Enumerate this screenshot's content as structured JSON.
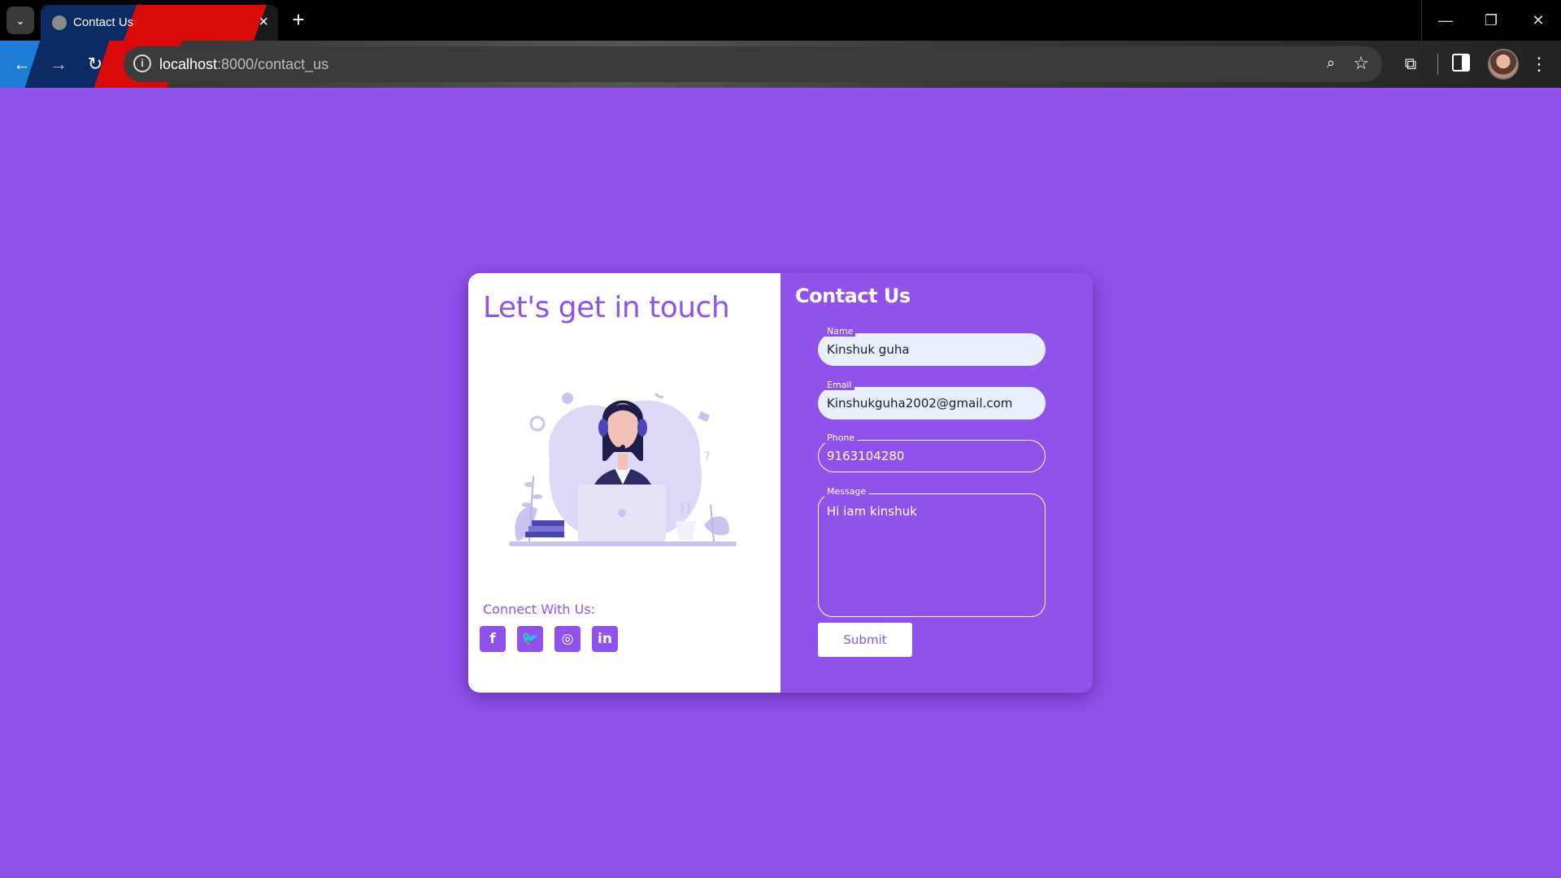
{
  "browser": {
    "tab_title": "Contact Us",
    "url_host": "localhost",
    "url_path": ":8000/contact_us",
    "icons": [
      "tab-search-icon",
      "globe-icon",
      "close-icon",
      "plus-icon",
      "minimize-icon",
      "restore-icon",
      "close-window-icon",
      "back-arrow-icon",
      "forward-arrow-icon",
      "reload-icon",
      "info-icon",
      "zoom-icon",
      "star-icon",
      "extensions-icon",
      "side-panel-icon",
      "avatar",
      "more-menu-icon"
    ]
  },
  "left": {
    "heading": "Let's get in touch",
    "connect_label": "Connect With Us:",
    "socials": [
      {
        "icon": "facebook-icon",
        "glyph": "f"
      },
      {
        "icon": "twitter-icon",
        "glyph": "🐦"
      },
      {
        "icon": "instagram-icon",
        "glyph": "◎"
      },
      {
        "icon": "linkedin-icon",
        "glyph": "in"
      }
    ]
  },
  "form": {
    "heading": "Contact Us",
    "name_label": "Name",
    "name_value": "Kinshuk guha",
    "email_label": "Email",
    "email_value": "Kinshukguha2002@gmail.com",
    "phone_label": "Phone",
    "phone_value": "9163104280",
    "message_label": "Message",
    "message_value": "Hi iam kinshuk",
    "submit_label": "Submit"
  },
  "colors": {
    "background": "#9152ec",
    "card_left": "#ffffff",
    "accent": "#9152ec",
    "filled_input": "#e8eefc"
  }
}
